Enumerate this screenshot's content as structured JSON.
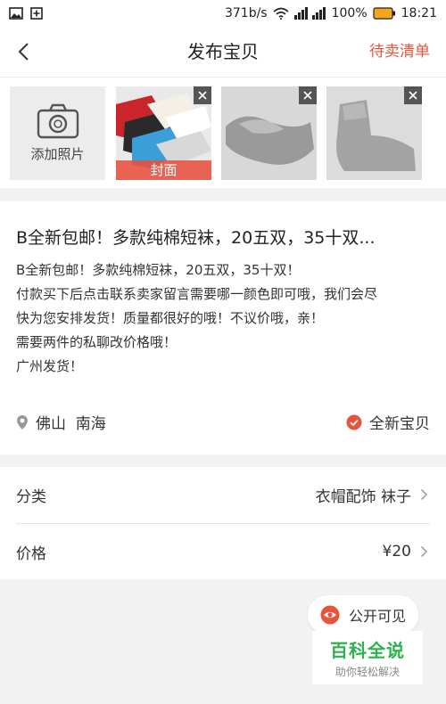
{
  "status_bar": {
    "speed": "371b/s",
    "battery": "100%",
    "time": "18:21",
    "icons": [
      "image-icon",
      "add-box-icon",
      "wifi-icon",
      "signal-icon",
      "battery-icon"
    ]
  },
  "header": {
    "title": "发布宝贝",
    "right_link": "待卖清单"
  },
  "photos": {
    "add_label": "添加照片",
    "cover_label": "封面",
    "thumbnails": [
      "socks-multicolor-photo",
      "gray-sock-photo",
      "gray-sock-side-photo"
    ]
  },
  "item": {
    "title": "B全新包邮！多款纯棉短袜，20五双，35十双...",
    "description_lines": [
      "B全新包邮！多款纯棉短袜，20五双，35十双！",
      "付款买下后点击联系卖家留言需要哪一颜色即可哦，我们会尽",
      "快为您安排发货！质量都很好的哦！不议价哦，亲！",
      "需要两件的私聊改价格哦！",
      "广州发货！"
    ],
    "location": "佛山  南海",
    "condition": "全新宝贝"
  },
  "rows": {
    "category_label": "分类",
    "category_value": "衣帽配饰 袜子",
    "price_label": "价格",
    "price_value": "¥20"
  },
  "visibility": {
    "label": "公开可见"
  },
  "watermark": {
    "main": "百科全说",
    "sub": "助你轻松解决"
  },
  "colors": {
    "accent": "#e8533b",
    "background": "#f2f2f2",
    "watermark_green": "#2bb34b"
  }
}
